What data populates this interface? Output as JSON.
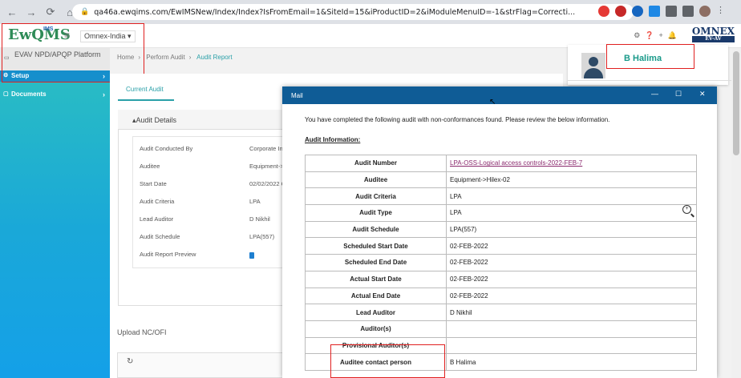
{
  "browser": {
    "url": "qa46a.ewqims.com/EwIMSNew/Index/Index?IsFromEmail=1&SiteId=15&iProductID=2&iModuleMenuID=-1&strFlag=Correcti...",
    "back": "←",
    "forward": "→",
    "reload": "⟳",
    "home": "⌂"
  },
  "header": {
    "logo": "EwQMS",
    "logo_sub": "IMS",
    "org": "Omnex-India ▾",
    "brand": "OMNEX",
    "brand_sub": "EV-AV"
  },
  "sidebar": {
    "platform": "EVAV NPD/APQP Platform",
    "items": [
      {
        "label": "Setup",
        "chevron": "›"
      },
      {
        "label": "Documents",
        "chevron": "›"
      }
    ]
  },
  "breadcrumb": [
    "Home",
    "Perform Audit",
    "Audit Report"
  ],
  "tabs": {
    "current": "Current Audit"
  },
  "details": {
    "title": "Audit Details",
    "rows": [
      {
        "label": "Audit Conducted By",
        "value": "Corporate In"
      },
      {
        "label": "Auditee",
        "value": "Equipment->"
      },
      {
        "label": "Start Date",
        "value": "02/02/2022 C"
      },
      {
        "label": "Audit Criteria",
        "value": "LPA"
      },
      {
        "label": "Lead Auditor",
        "value": "D Nikhil"
      },
      {
        "label": "Audit Schedule",
        "value": "LPA(557)"
      },
      {
        "label": "Audit Report Preview",
        "value": ""
      }
    ]
  },
  "upload": {
    "title": "Upload NC/OFI"
  },
  "profile": {
    "name": "B Halima"
  },
  "mail": {
    "title": "Mail",
    "intro": "You have completed the following audit with non-conformances found. Please review the below information.",
    "section": "Audit Information:",
    "rows": [
      {
        "label": "Audit Number",
        "value": "LPA-OSS-Logical access controls-2022-FEB-7",
        "link": true
      },
      {
        "label": "Auditee",
        "value": "Equipment->Hilex-02"
      },
      {
        "label": "Audit Criteria",
        "value": "LPA"
      },
      {
        "label": "Audit Type",
        "value": "LPA"
      },
      {
        "label": "Audit Schedule",
        "value": "LPA(557)"
      },
      {
        "label": "Scheduled Start Date",
        "value": "02-FEB-2022"
      },
      {
        "label": "Scheduled End Date",
        "value": "02-FEB-2022"
      },
      {
        "label": "Actual Start Date",
        "value": "02-FEB-2022"
      },
      {
        "label": "Actual End Date",
        "value": "02-FEB-2022"
      },
      {
        "label": "Lead Auditor",
        "value": "D Nikhil"
      },
      {
        "label": "Auditor(s)",
        "value": ""
      },
      {
        "label": "Provisional Auditor(s)",
        "value": ""
      },
      {
        "label": "Auditee contact person",
        "value": "B Halima"
      }
    ]
  },
  "colors": {
    "accent": "#2aa0a8",
    "mail_bar": "#0f5c96",
    "highlight": "#e02020"
  }
}
